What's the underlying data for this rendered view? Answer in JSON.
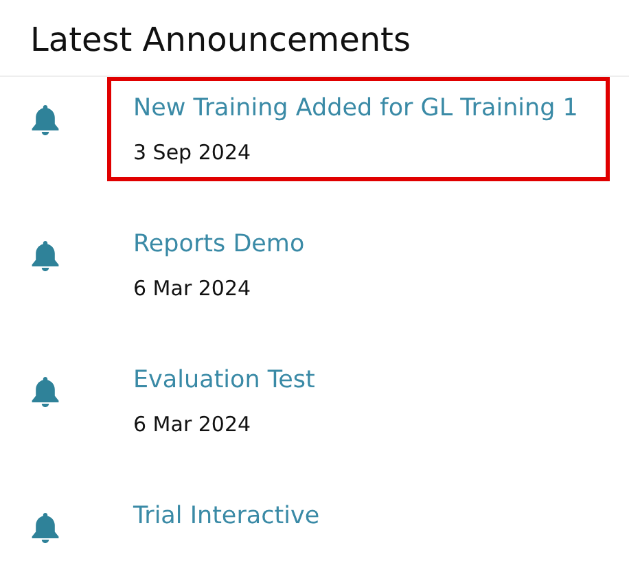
{
  "title": "Latest Announcements",
  "announcements": [
    {
      "title": "New Training Added for GL Training 1",
      "date": "3 Sep 2024",
      "highlighted": true
    },
    {
      "title": "Reports Demo",
      "date": "6 Mar 2024",
      "highlighted": false
    },
    {
      "title": "Evaluation Test",
      "date": "6 Mar 2024",
      "highlighted": false
    },
    {
      "title": "Trial Interactive",
      "highlighted": false
    }
  ]
}
